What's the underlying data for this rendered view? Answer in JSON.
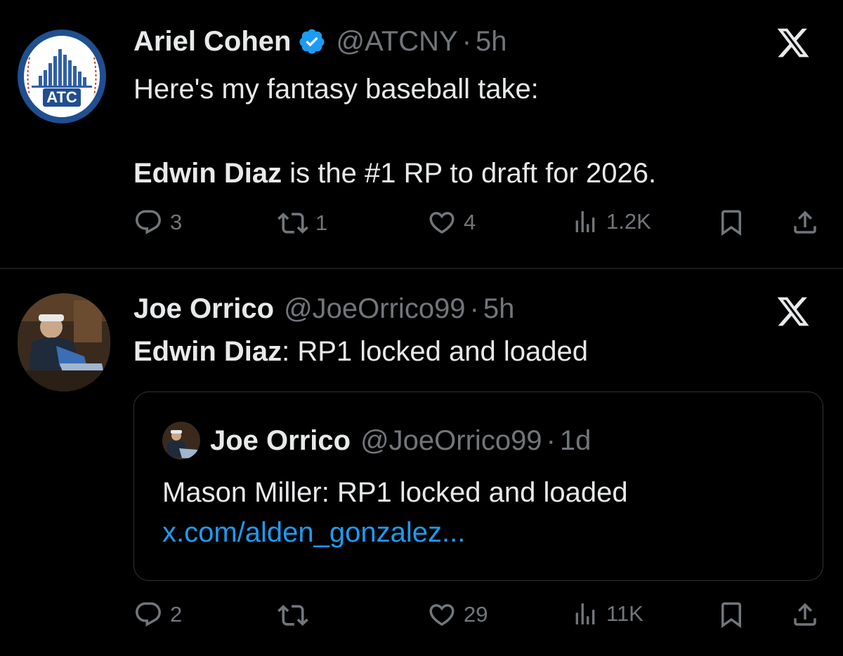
{
  "tweets": [
    {
      "author_name": "Ariel Cohen",
      "handle": "@ATCNY",
      "separator": "·",
      "time": "5h",
      "avatar_text": "ATC",
      "verified": true,
      "line1": "Here's my fantasy baseball take:",
      "line2_bold": "Edwin Diaz",
      "line2_rest": " is the #1 RP to draft for 2026.",
      "actions": {
        "replies": "3",
        "reposts": "1",
        "likes": "4",
        "views": "1.2K"
      }
    },
    {
      "author_name": "Joe Orrico",
      "handle": "@JoeOrrico99",
      "separator": "·",
      "time": "5h",
      "line1_bold": "Edwin Diaz",
      "line1_rest": ": RP1 locked and loaded",
      "quote": {
        "author_name": "Joe Orrico",
        "handle": "@JoeOrrico99",
        "separator": "·",
        "time": "1d",
        "text": "Mason Miller: RP1 locked and loaded",
        "link": "x.com/alden_gonzalez..."
      },
      "actions": {
        "replies": "2",
        "reposts": "",
        "likes": "29",
        "views": "11K"
      }
    }
  ],
  "colors": {
    "background": "#000000",
    "text": "#e7e9ea",
    "muted": "#71767b",
    "link": "#1d9bf0",
    "verified": "#1d9bf0",
    "divider": "#2f3336"
  },
  "icons": [
    "x-logo-icon",
    "verified-badge-icon",
    "reply-icon",
    "repost-icon",
    "like-icon",
    "views-icon",
    "bookmark-icon",
    "share-icon"
  ]
}
